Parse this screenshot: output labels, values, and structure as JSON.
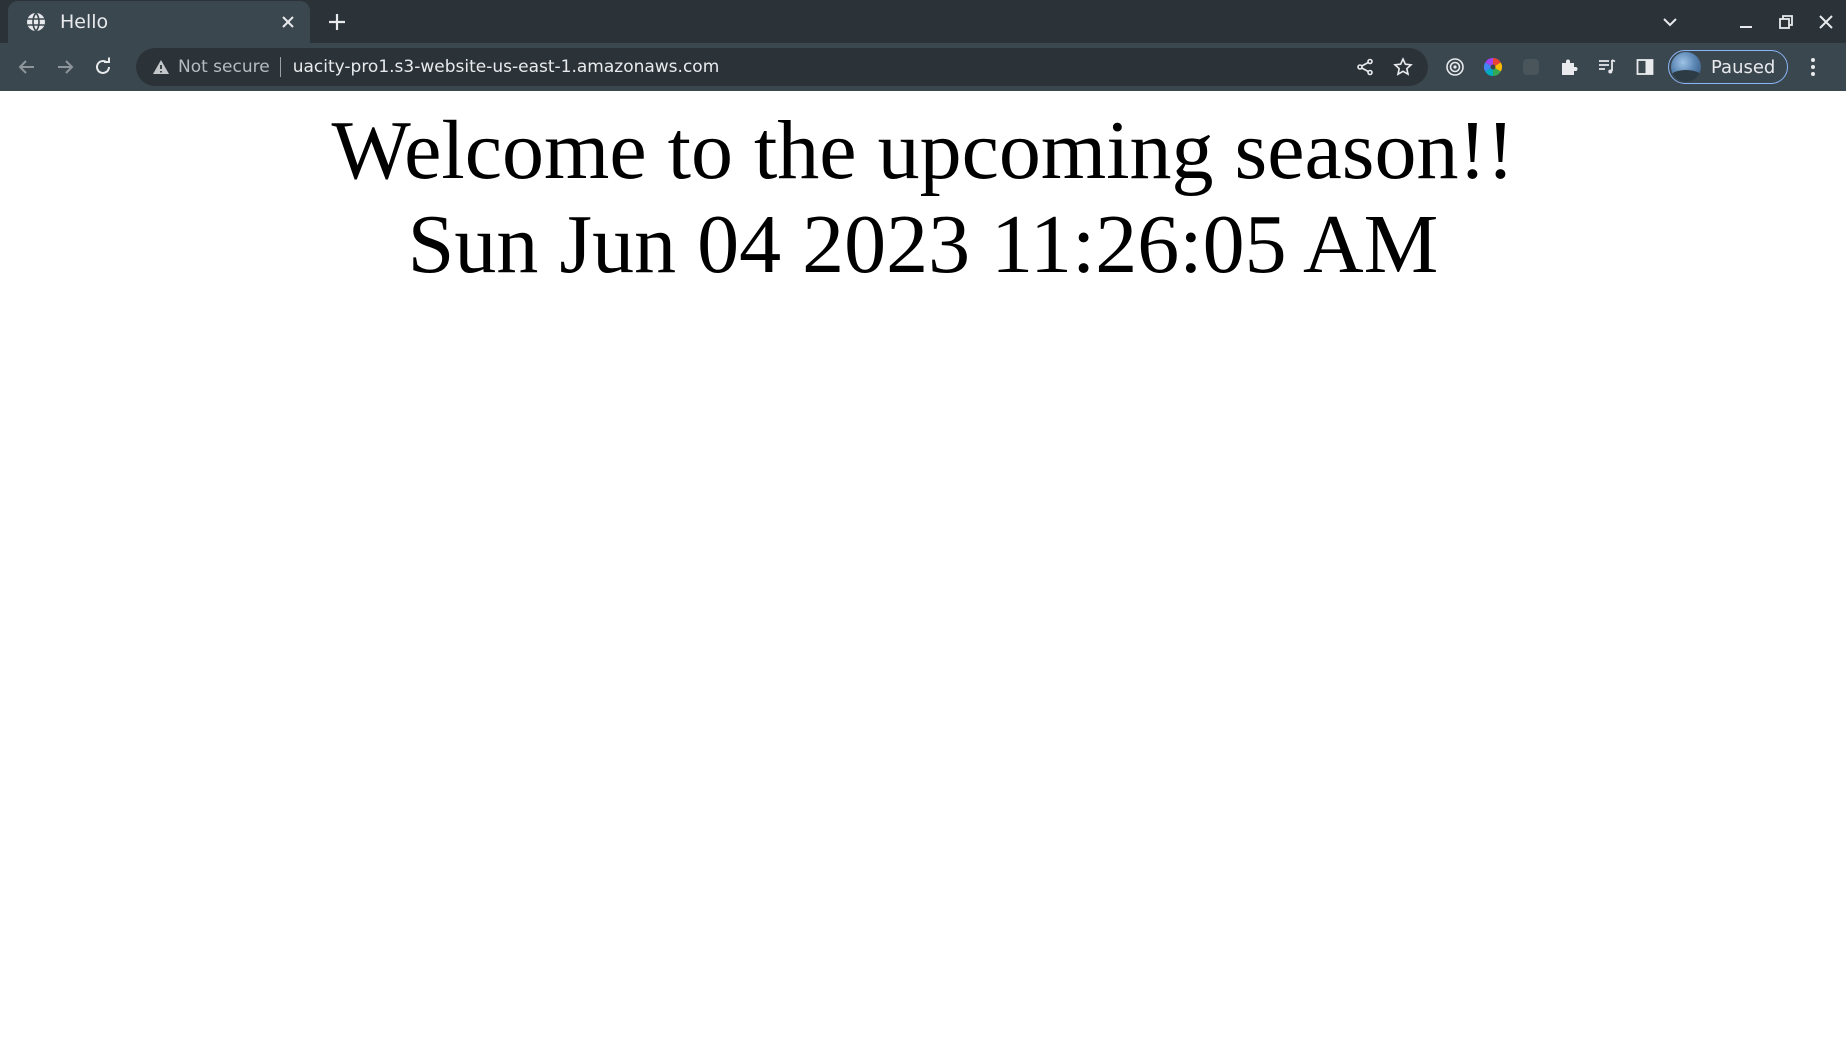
{
  "browser": {
    "tab": {
      "title": "Hello",
      "favicon": "globe-icon",
      "close": "close-icon"
    },
    "new_tab": "plus-icon",
    "window_controls": [
      "chevron-down-icon",
      "minimize-icon",
      "restore-icon",
      "close-icon"
    ],
    "toolbar": {
      "back": "arrow-left-icon",
      "forward": "arrow-right-icon",
      "reload": "reload-icon",
      "security_label": "Not secure",
      "url": "uacity-pro1.s3-website-us-east-1.amazonaws.com",
      "profile_label": "Paused"
    },
    "colors": {
      "tabstrip": "#2b3338",
      "toolbar": "#3b474e",
      "omnibox": "#2b3338",
      "profile_border": "#8ab4f8"
    }
  },
  "page": {
    "heading": "Welcome to the upcoming season!!",
    "datetime": "Sun Jun 04 2023 11:26:05 AM"
  }
}
